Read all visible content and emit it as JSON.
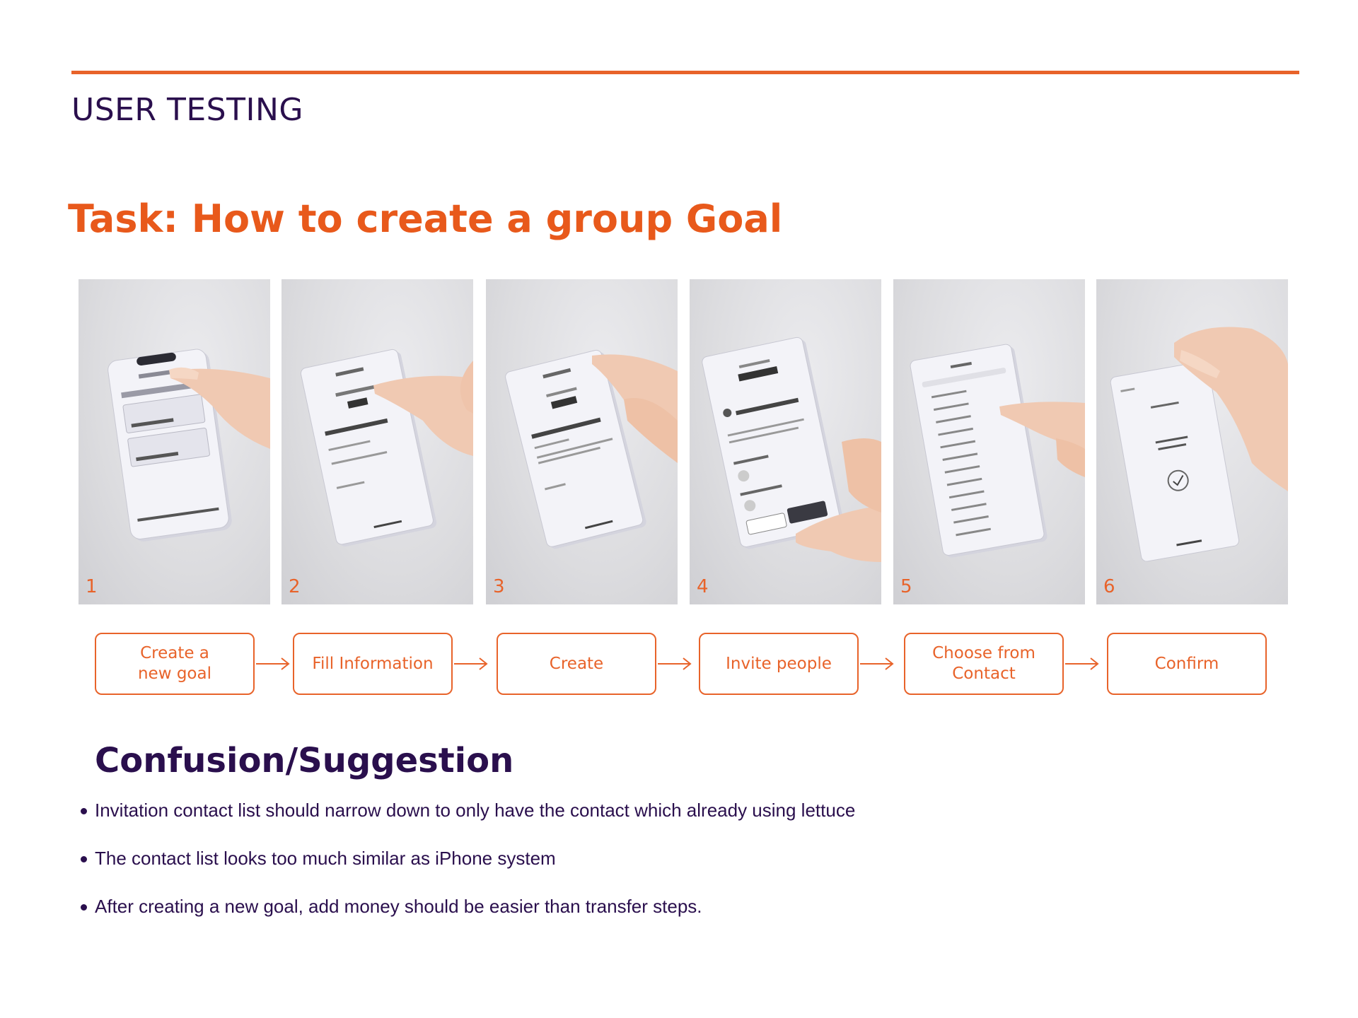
{
  "header": {
    "section_title": "USER TESTING"
  },
  "task": {
    "title": "Task: How to create a group Goal"
  },
  "photos": [
    {
      "number": "1"
    },
    {
      "number": "2"
    },
    {
      "number": "3"
    },
    {
      "number": "4"
    },
    {
      "number": "5"
    },
    {
      "number": "6"
    }
  ],
  "steps": [
    {
      "label": "Create a\nnew goal"
    },
    {
      "label": "Fill Information"
    },
    {
      "label": "Create"
    },
    {
      "label": "Invite people"
    },
    {
      "label": "Choose from\nContact"
    },
    {
      "label": "Confirm"
    }
  ],
  "confusion": {
    "title": "Confusion/Suggestion",
    "items": [
      "Invitation contact list should narrow down to only have the contact which already using lettuce",
      "The contact list looks too much similar as  iPhone system",
      "After creating a new goal, add money should be easier than transfer steps."
    ]
  },
  "colors": {
    "accent": "#e8632a",
    "heading": "#2a0f4d"
  },
  "icons": [
    "arrow-right-icon",
    "checkmark-icon"
  ]
}
